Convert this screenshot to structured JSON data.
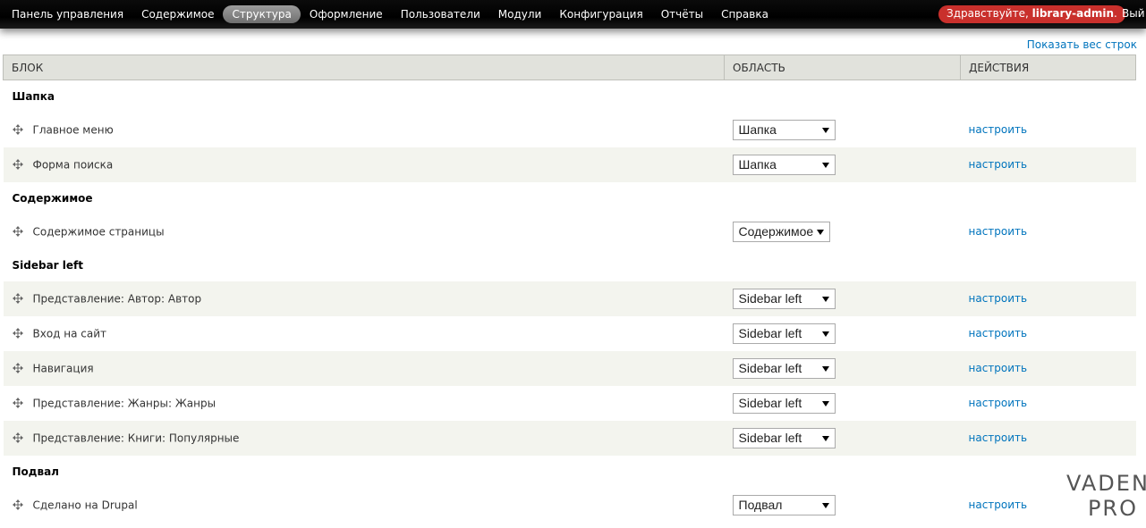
{
  "toolbar": {
    "items": [
      {
        "label": "Панель управления"
      },
      {
        "label": "Содержимое"
      },
      {
        "label": "Структура",
        "active": true
      },
      {
        "label": "Оформление"
      },
      {
        "label": "Пользователи"
      },
      {
        "label": "Модули"
      },
      {
        "label": "Конфигурация"
      },
      {
        "label": "Отчёты"
      },
      {
        "label": "Справка"
      }
    ],
    "greeting_prefix": "Здравствуйте, ",
    "greeting_user": "library-admin",
    "greeting_suffix": ".",
    "logout": "Вый"
  },
  "show_weights": "Показать вес строк",
  "table": {
    "headers": {
      "block": "Блок",
      "region": "Область",
      "operations": "Действия"
    },
    "regions": [
      {
        "title": "Шапка",
        "blocks": [
          {
            "name": "Главное меню",
            "region": "Шапка",
            "op": "настроить"
          },
          {
            "name": "Форма поиска",
            "region": "Шапка",
            "op": "настроить"
          }
        ]
      },
      {
        "title": "Содержимое",
        "blocks": [
          {
            "name": "Содержимое страницы",
            "region": "Содержимое",
            "op": "настроить"
          }
        ]
      },
      {
        "title": "Sidebar left",
        "blocks": [
          {
            "name": "Представление: Автор: Автор",
            "region": "Sidebar left",
            "op": "настроить"
          },
          {
            "name": "Вход на сайт",
            "region": "Sidebar left",
            "op": "настроить"
          },
          {
            "name": "Навигация",
            "region": "Sidebar left",
            "op": "настроить"
          },
          {
            "name": "Представление: Жанры: Жанры",
            "region": "Sidebar left",
            "op": "настроить"
          },
          {
            "name": "Представление: Книги: Популярные",
            "region": "Sidebar left",
            "op": "настроить"
          }
        ]
      },
      {
        "title": "Подвал",
        "blocks": [
          {
            "name": "Сделано на Drupal",
            "region": "Подвал",
            "op": "настроить"
          }
        ]
      }
    ]
  },
  "watermark": {
    "line1": "VADEN",
    "line2": "PRO"
  },
  "colors": {
    "link": "#0074bd",
    "greeting_bg": "#c9302c",
    "header_bg": "#e1e2dc",
    "even_row": "#f3f4ee"
  }
}
